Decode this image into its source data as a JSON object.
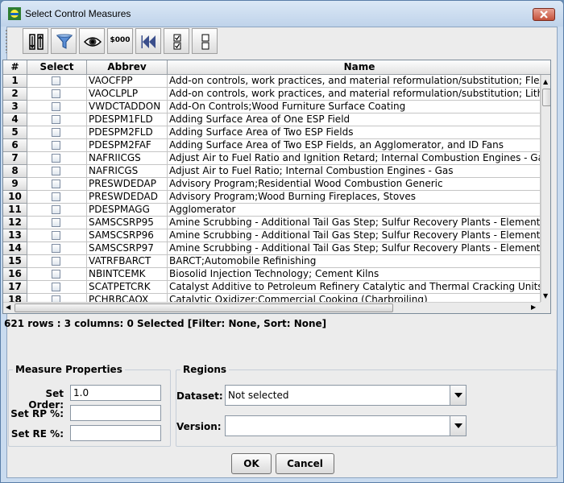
{
  "window": {
    "title": "Select Control Measures"
  },
  "toolbar": {
    "money_label": "$000"
  },
  "table": {
    "columns": [
      "#",
      "Select",
      "Abbrev",
      "Name"
    ],
    "rows": [
      {
        "n": "1",
        "abbrev": "VAOCFPP",
        "name": "Add-on controls, work practices, and material reformulation/substitution; Flexible Package Printing"
      },
      {
        "n": "2",
        "abbrev": "VAOCLPLP",
        "name": "Add-on controls, work practices, and material reformulation/substitution; Lithographic Printing"
      },
      {
        "n": "3",
        "abbrev": "VWDCTADDON",
        "name": "Add-On Controls;Wood Furniture Surface Coating"
      },
      {
        "n": "4",
        "abbrev": "PDESPM1FLD",
        "name": "Adding Surface Area of One ESP Field"
      },
      {
        "n": "5",
        "abbrev": "PDESPM2FLD",
        "name": "Adding Surface Area of Two ESP Fields"
      },
      {
        "n": "6",
        "abbrev": "PDESPM2FAF",
        "name": "Adding Surface Area of Two ESP Fields, an Agglomerator, and ID Fans"
      },
      {
        "n": "7",
        "abbrev": "NAFRIICGS",
        "name": "Adjust Air to Fuel Ratio and Ignition Retard; Internal Combustion Engines - Gas"
      },
      {
        "n": "8",
        "abbrev": "NAFRICGS",
        "name": "Adjust Air to Fuel Ratio; Internal Combustion Engines - Gas"
      },
      {
        "n": "9",
        "abbrev": "PRESWDEDAP",
        "name": "Advisory Program;Residential Wood Combustion Generic"
      },
      {
        "n": "10",
        "abbrev": "PRESWDEDAD",
        "name": "Advisory Program;Wood Burning Fireplaces, Stoves"
      },
      {
        "n": "11",
        "abbrev": "PDESPMAGG",
        "name": "Agglomerator"
      },
      {
        "n": "12",
        "abbrev": "SAMSCSRP95",
        "name": "Amine Scrubbing - Additional Tail Gas Step; Sulfur Recovery Plants - Elemental Sulfur"
      },
      {
        "n": "13",
        "abbrev": "SAMSCSRP96",
        "name": "Amine Scrubbing - Additional Tail Gas Step; Sulfur Recovery Plants - Elemental Sulfur"
      },
      {
        "n": "14",
        "abbrev": "SAMSCSRP97",
        "name": "Amine Scrubbing - Additional Tail Gas Step; Sulfur Recovery Plants - Elemental Sulfur"
      },
      {
        "n": "15",
        "abbrev": "VATRFBARCT",
        "name": "BARCT;Automobile Refinishing"
      },
      {
        "n": "16",
        "abbrev": "NBINTCEMK",
        "name": "Biosolid Injection Technology; Cement Kilns"
      },
      {
        "n": "17",
        "abbrev": "SCATPETCRK",
        "name": "Catalyst Additive to Petroleum Refinery Catalytic and Thermal Cracking Units"
      },
      {
        "n": "18",
        "abbrev": "PCHRBCAOX",
        "name": "Catalytic Oxidizer;Commercial Cooking (Charbroiling)"
      }
    ]
  },
  "status": "621 rows : 3 columns: 0 Selected [Filter: None, Sort: None]",
  "measure_properties": {
    "legend": "Measure Properties",
    "set_order_label": "Set Order:",
    "set_order_value": "1.0",
    "set_rp_label": "Set RP %:",
    "set_rp_value": "",
    "set_re_label": "Set RE %:",
    "set_re_value": ""
  },
  "regions": {
    "legend": "Regions",
    "dataset_label": "Dataset:",
    "dataset_value": "Not selected",
    "version_label": "Version:",
    "version_value": ""
  },
  "buttons": {
    "ok": "OK",
    "cancel": "Cancel"
  }
}
